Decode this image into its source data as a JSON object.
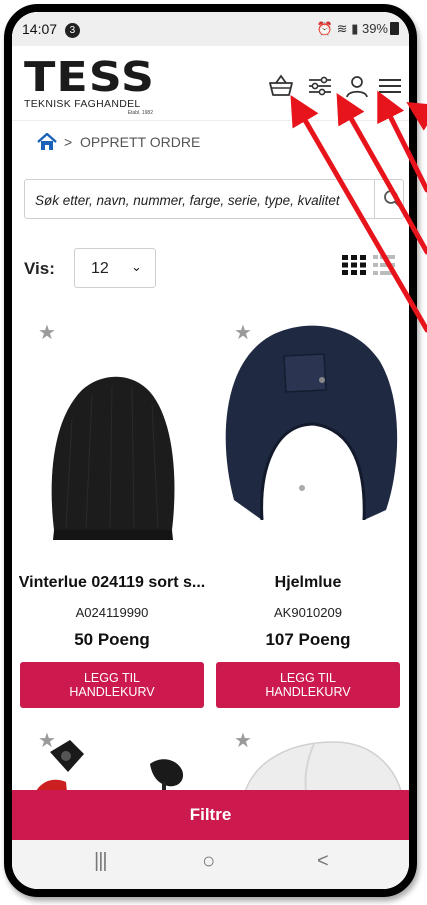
{
  "statusbar": {
    "time": "14:07",
    "notification_count": "3",
    "battery": "39%"
  },
  "header": {
    "logo_text": "TESS",
    "logo_subtitle": "TEKNISK FAGHANDEL",
    "logo_since": "Etabl. 1982",
    "icons": [
      "basket-icon",
      "filter-sliders-icon",
      "user-icon",
      "hamburger-menu-icon"
    ]
  },
  "breadcrumb": {
    "label": "OPPRETT ORDRE"
  },
  "search": {
    "placeholder": "Søk etter, navn, nummer, farge, serie, type, kvalitet"
  },
  "display": {
    "label": "Vis:",
    "value": "12"
  },
  "products": [
    {
      "name": "Vinterlue 024119 sort s...",
      "sku": "A024119990",
      "points": "50 Poeng",
      "button_line1": "LEGG TIL",
      "button_line2": "HANDLEKURV"
    },
    {
      "name": "Hjelmlue",
      "sku": "AK9010209",
      "points": "107 Poeng",
      "button_line1": "LEGG TIL",
      "button_line2": "HANDLEKURV"
    }
  ],
  "filter_button": {
    "label": "Filtre"
  },
  "nav": {
    "recent": "|||",
    "home": "○",
    "back": "<"
  },
  "colors": {
    "accent": "#cc1a4f",
    "annotation_arrows": "#e8141b"
  }
}
